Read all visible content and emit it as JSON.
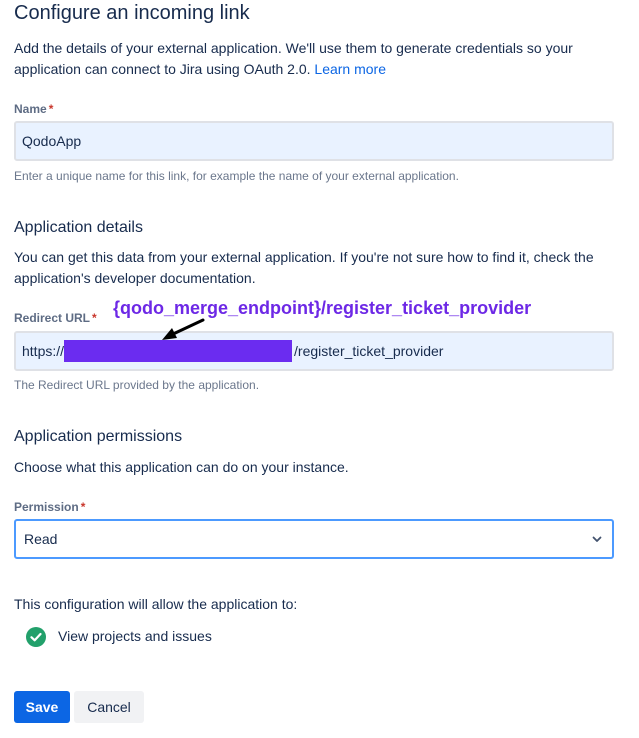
{
  "page": {
    "title": "Configure an incoming link",
    "intro": "Add the details of your external application. We'll use them to generate credentials so your application can connect to Jira using OAuth 2.0.",
    "learn_more": "Learn more"
  },
  "name_field": {
    "label": "Name",
    "required_mark": "*",
    "value": "QodoApp",
    "help": "Enter a unique name for this link, for example the name of your external application."
  },
  "application_details": {
    "title": "Application details",
    "description": "You can get this data from your external application. If you're not sure how to find it, check the application's developer documentation."
  },
  "redirect_field": {
    "label": "Redirect URL",
    "required_mark": "*",
    "value_prefix": "https://",
    "value_suffix": "/register_ticket_provider",
    "help": "The Redirect URL provided by the application.",
    "annotation": "{qodo_merge_endpoint}/register_ticket_provider",
    "redaction_color": "#6b2cf0"
  },
  "application_permissions": {
    "title": "Application permissions",
    "description": "Choose what this application can do on your instance."
  },
  "permission_field": {
    "label": "Permission",
    "required_mark": "*",
    "selected": "Read",
    "icon": "chevron-down-icon"
  },
  "allow": {
    "intro": "This configuration will allow the application to:",
    "items": [
      {
        "label": "View projects and issues",
        "icon": "check-circle-icon"
      }
    ]
  },
  "buttons": {
    "save": "Save",
    "cancel": "Cancel"
  },
  "colors": {
    "primary": "#0c66e4",
    "field_bg": "#e9f2ff",
    "success": "#22a06b",
    "annotation": "#6d28e6",
    "required": "#c9372c"
  }
}
